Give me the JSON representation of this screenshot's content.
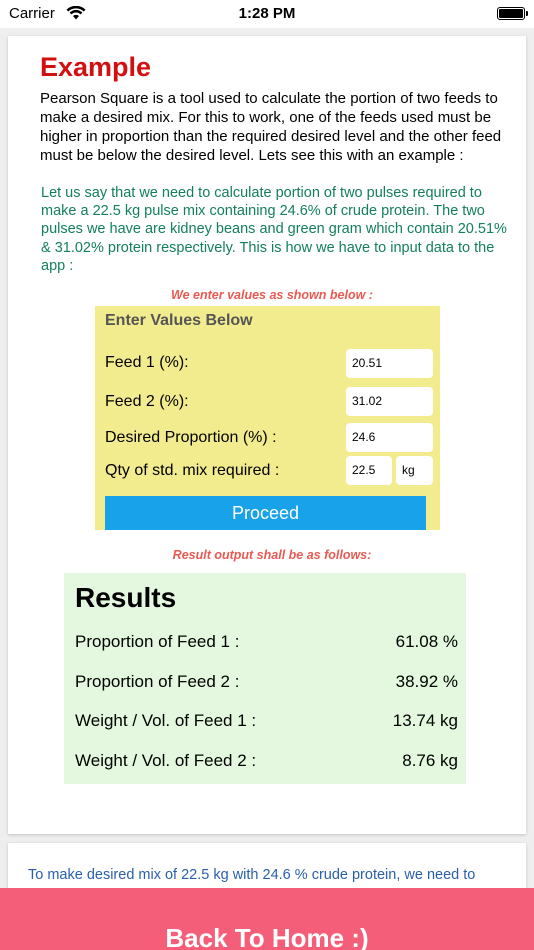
{
  "status_bar": {
    "carrier": "Carrier",
    "time": "1:28 PM"
  },
  "example": {
    "title": "Example",
    "intro": "Pearson Square is a tool used to calculate the portion of two feeds to make a desired mix. For this to work, one of the feeds used must be higher in proportion than the required desired level and the other feed must be below the desired level. Lets see this with an example :",
    "scenario": "Let us say that we need to calculate portion of two pulses required to make a 22.5 kg pulse mix containing 24.6% of crude protein. The two pulses we have are kidney beans and green gram which contain 20.51% & 31.02% protein respectively. This is how we have to input data to the app :",
    "input_caption": "We enter values as shown below :",
    "result_caption": "Result output shall be as follows:"
  },
  "input_panel": {
    "title": "Enter Values Below",
    "feed1_label": "Feed 1 (%):",
    "feed1_value": "20.51",
    "feed2_label": "Feed 2 (%):",
    "feed2_value": "31.02",
    "desired_label": "Desired Proportion (%) :",
    "desired_value": "24.6",
    "qty_label": "Qty of std. mix required :",
    "qty_value": "22.5",
    "qty_unit": "kg",
    "proceed_label": "Proceed"
  },
  "results": {
    "title": "Results",
    "rows": [
      {
        "label": "Proportion of Feed 1  :",
        "value": "61.08 %"
      },
      {
        "label": "Proportion of Feed 2  :",
        "value": "38.92 %"
      },
      {
        "label": "Weight / Vol. of Feed 1 :",
        "value": "13.74 kg"
      },
      {
        "label": "Weight / Vol. of Feed 2 :",
        "value": "8.76 kg"
      }
    ]
  },
  "next_card": {
    "text": "To make desired mix of 22.5 kg with 24.6 % crude protein, we need to"
  },
  "home_button": {
    "label": "Back To Home :)"
  },
  "colors": {
    "title_red": "#d40f0f",
    "scenario_green": "#13805a",
    "caption_red": "#e85a52",
    "input_panel_yellow": "#f3ec8e",
    "proceed_blue": "#17a2ea",
    "results_green": "#e3f8de",
    "home_button_pink": "#f45e78"
  }
}
